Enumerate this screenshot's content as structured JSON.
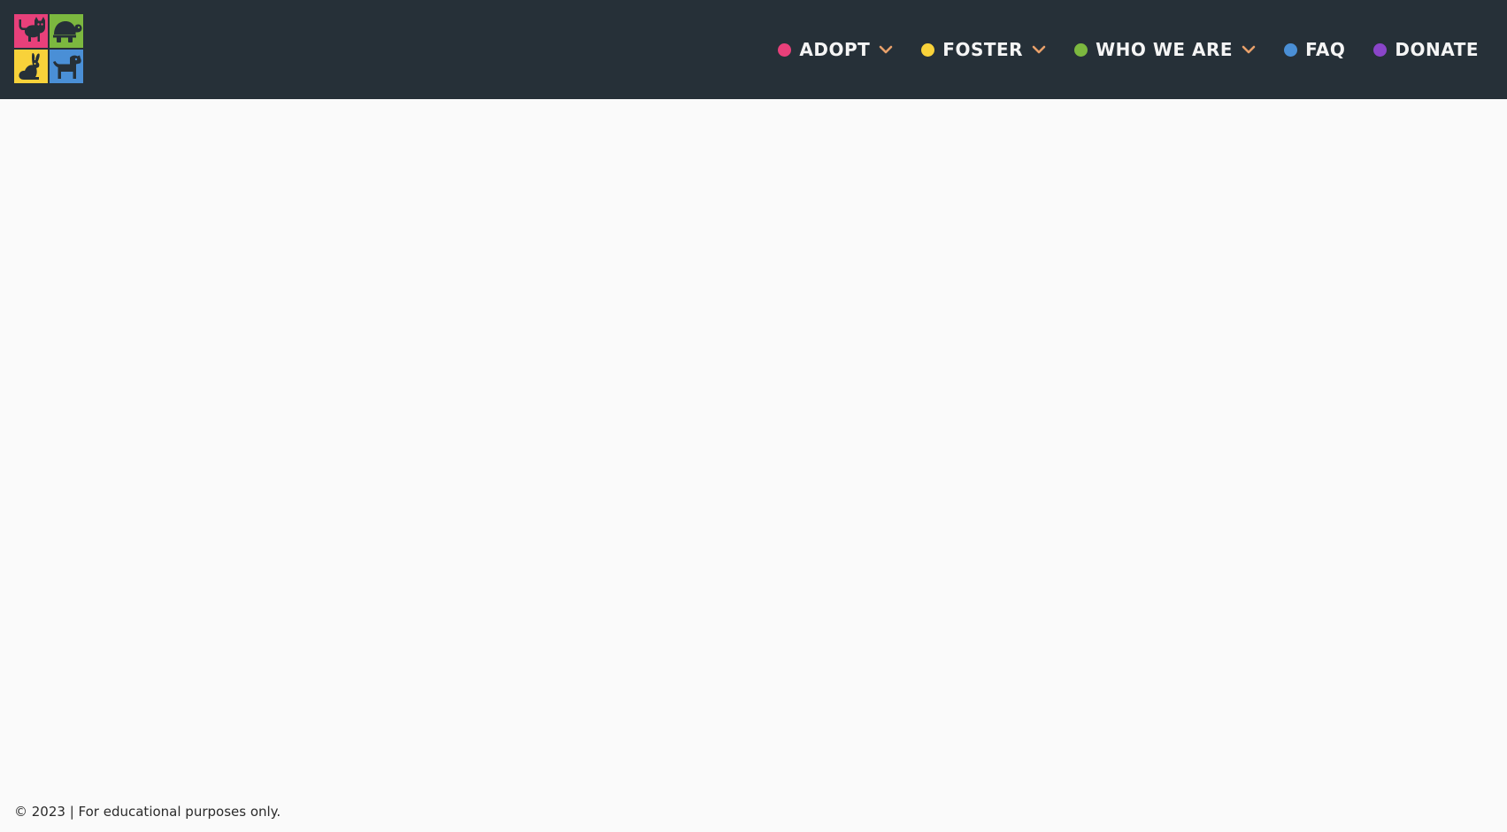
{
  "logo": {
    "tiles": [
      {
        "icon": "cat-icon",
        "color": "#e8407a"
      },
      {
        "icon": "turtle-icon",
        "color": "#7cb83f"
      },
      {
        "icon": "rabbit-icon",
        "color": "#f8d23a"
      },
      {
        "icon": "dog-icon",
        "color": "#4a8fd6"
      }
    ]
  },
  "nav": {
    "items": [
      {
        "label": "ADOPT",
        "dot_color": "#e8407a",
        "has_dropdown": true
      },
      {
        "label": "FOSTER",
        "dot_color": "#f8d23a",
        "has_dropdown": true
      },
      {
        "label": "WHO WE ARE",
        "dot_color": "#7cb83f",
        "has_dropdown": true
      },
      {
        "label": "FAQ",
        "dot_color": "#4a8fd6",
        "has_dropdown": false
      },
      {
        "label": "DONATE",
        "dot_color": "#8a45c9",
        "has_dropdown": false
      }
    ],
    "chevron_color": "#e8a06a"
  },
  "colors": {
    "header_bg": "#263038",
    "page_bg": "#fafafa",
    "nav_text": "#f5f5f5"
  },
  "footer": {
    "text": "© 2023 | For educational purposes only."
  }
}
